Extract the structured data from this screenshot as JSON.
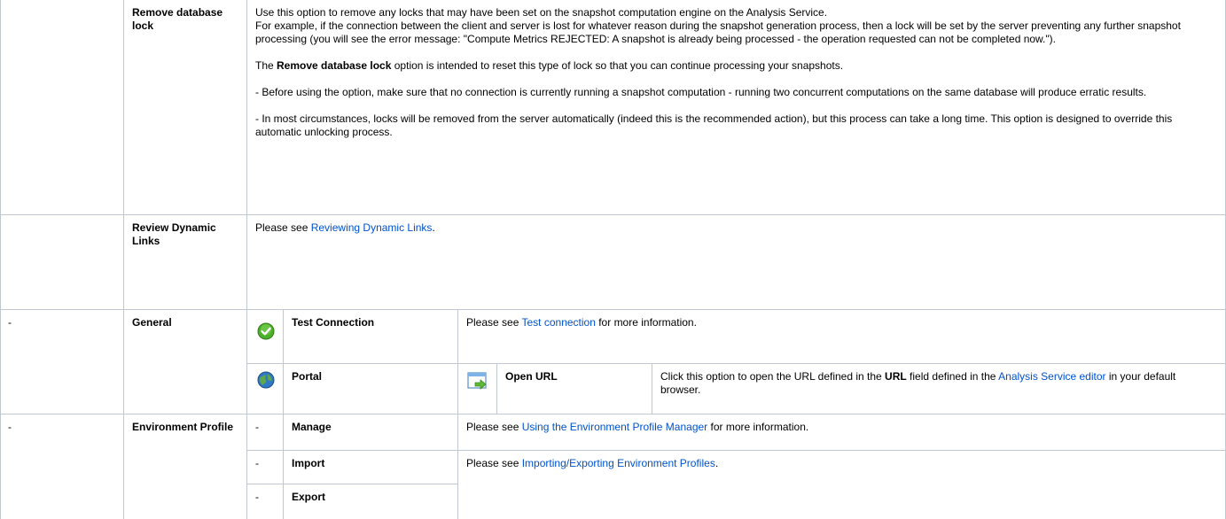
{
  "lock_row": {
    "title": "Remove database lock",
    "line1": "Use this option to remove any locks that may have been set on the snapshot computation engine on the Analysis Service.",
    "line2": "For example, if the connection between the client and server is lost for whatever reason during the snapshot generation process, then a lock will be set by the server preventing any further snapshot processing (you will see the error message: \"Compute Metrics REJECTED: A snapshot is already being processed - the operation requested can not be completed now.\").",
    "p2_pre": "The ",
    "p2_bold": "Remove database lock",
    "p2_post": " option is intended to reset this type of lock so that you can continue processing your snapshots.",
    "p3": "- Before using the option, make sure that no connection is currently running a snapshot computation - running two concurrent computations on the same database will produce erratic results.",
    "p4": "- In most circumstances, locks will be removed from the server automatically (indeed this is the recommended action), but this process can take a long time. This option is designed to override this automatic unlocking process."
  },
  "dynamic_row": {
    "title": "Review Dynamic Links",
    "pre": "Please see ",
    "link": "Reviewing Dynamic Links",
    "post": "."
  },
  "general": {
    "dash": "-",
    "title": "General",
    "test": {
      "icon": "green-check-icon",
      "label": "Test Connection",
      "pre": "Please see ",
      "link": "Test connection",
      "post": " for more information."
    },
    "portal": {
      "icon": "globe-icon",
      "label": "Portal",
      "sub_icon": "open-url-window-arrow-icon",
      "sub_label": "Open URL",
      "d1": "Click this option to open the URL defined in the ",
      "d_bold": "URL",
      "d2": " field defined in the ",
      "link": "Analysis Service editor",
      "d3": " in your default browser."
    }
  },
  "env": {
    "dash": "-",
    "title": "Environment Profile",
    "manage": {
      "dash": "-",
      "label": "Manage",
      "pre": "Please see ",
      "link": "Using the Environment Profile Manager",
      "post": " for more information."
    },
    "import": {
      "dash": "-",
      "label": "Import",
      "pre": "Please see ",
      "link": "Importing/Exporting Environment Profiles",
      "post": "."
    },
    "export": {
      "dash": "-",
      "label": "Export"
    }
  },
  "colors": {
    "border": "#c1c7d0",
    "link": "#0052cc",
    "check_green": "#4caf2a"
  }
}
